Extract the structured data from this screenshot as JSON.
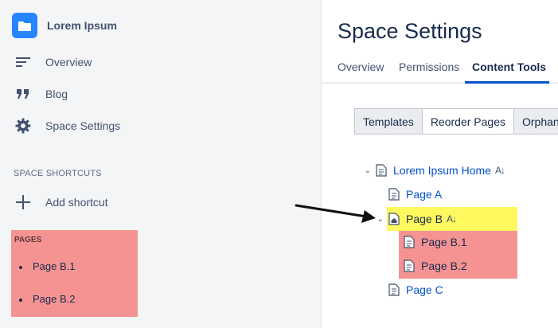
{
  "sidebar": {
    "space_name": "Lorem Ipsum",
    "nav": {
      "overview": "Overview",
      "blog": "Blog",
      "space_settings": "Space Settings"
    },
    "shortcuts_title": "SPACE SHORTCUTS",
    "add_shortcut": "Add shortcut",
    "pages": {
      "title": "PAGES",
      "items": [
        "Page B.1",
        "Page B.2"
      ]
    }
  },
  "main": {
    "title": "Space Settings",
    "tabs": [
      "Overview",
      "Permissions",
      "Content Tools"
    ],
    "active_tab": "Content Tools",
    "sub_tabs": [
      "Templates",
      "Reorder Pages",
      "Orphane"
    ],
    "active_sub_tab": "Reorder Pages",
    "tree": {
      "root": "Lorem Ipsum Home",
      "page_a": "Page A",
      "page_b": "Page B",
      "page_b1": "Page B.1",
      "page_b2": "Page B.2",
      "page_c": "Page C"
    }
  },
  "colors": {
    "accent": "#0052cc",
    "logo": "#2684ff",
    "highlight_yellow": "#fff85e",
    "highlight_red": "#f59393"
  }
}
